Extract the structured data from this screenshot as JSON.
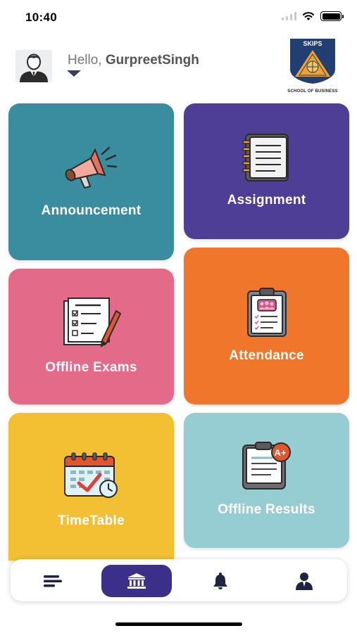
{
  "status_bar": {
    "time": "10:40",
    "icons": [
      "signal-icon",
      "wifi-icon",
      "battery-icon"
    ]
  },
  "header": {
    "greeting": "Hello,",
    "user_name": "GurpreetSingh",
    "logo_text": "SKIPS",
    "logo_caption": "SCHOOL OF BUSINESS"
  },
  "tiles": [
    {
      "label": "Announcement",
      "icon": "megaphone-icon",
      "color": "#3a8d9f"
    },
    {
      "label": "Assignment",
      "icon": "notebook-icon",
      "color": "#4e3e96"
    },
    {
      "label": "Offline Exams",
      "icon": "exam-sheet-icon",
      "color": "#e46a8a"
    },
    {
      "label": "Attendance",
      "icon": "clipboard-icon",
      "color": "#f0762c"
    },
    {
      "label": "TimeTable",
      "icon": "calendar-icon",
      "color": "#f3c034"
    },
    {
      "label": "Offline Results",
      "icon": "result-sheet-icon",
      "color": "#96cdd2"
    }
  ],
  "bottom_nav": {
    "items": [
      "menu-icon",
      "home-bank-icon",
      "bell-icon",
      "profile-icon"
    ],
    "active": "home-bank-icon",
    "active_color": "#3b2f8a"
  }
}
